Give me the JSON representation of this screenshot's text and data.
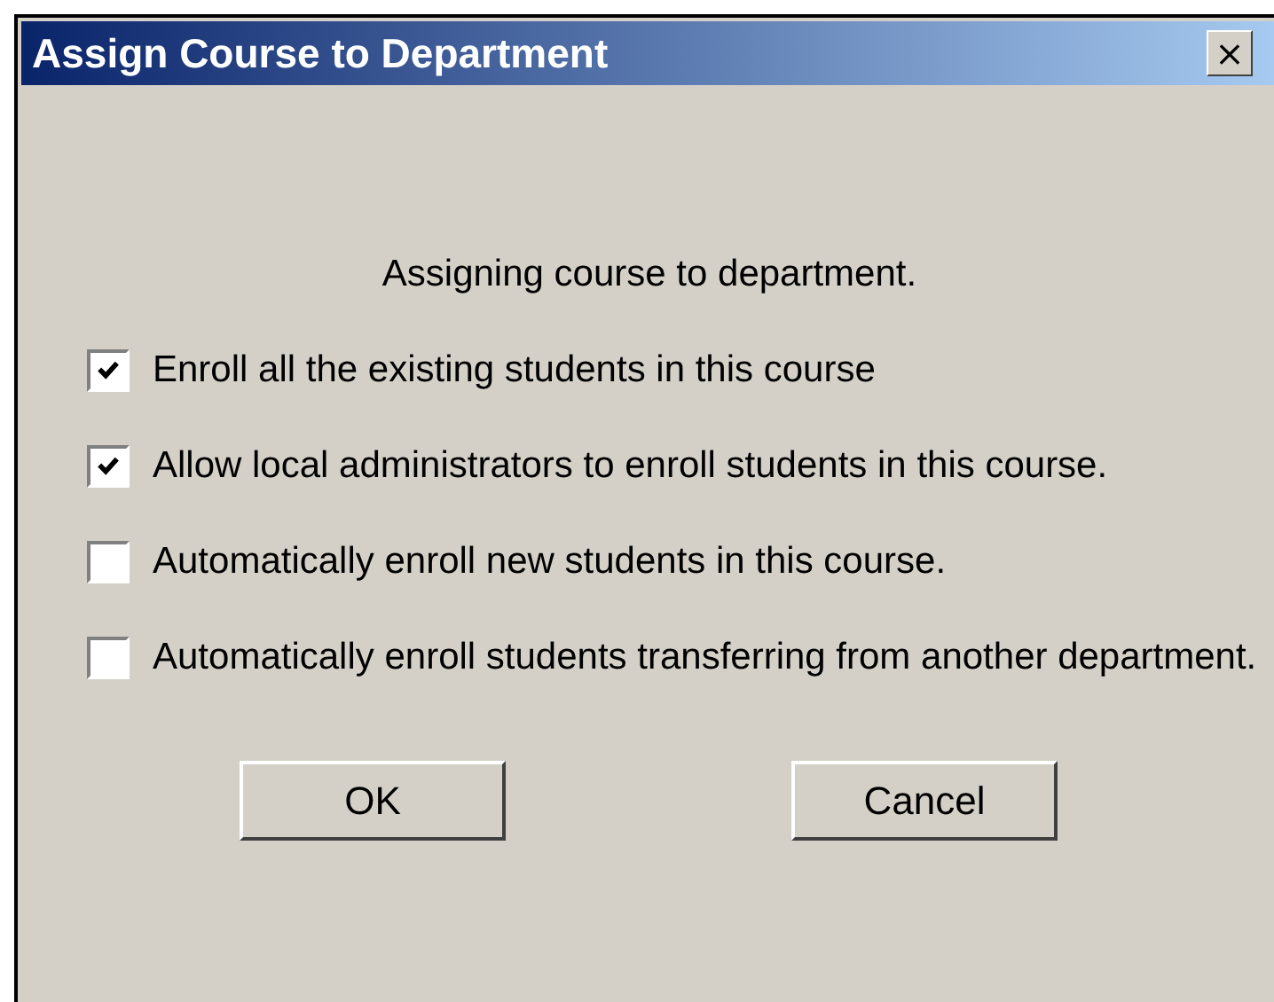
{
  "window": {
    "title": "Assign Course to Department",
    "close": "×"
  },
  "message": "Assigning course to department.",
  "options": [
    {
      "label": "Enroll all the existing students in this course",
      "checked": true
    },
    {
      "label": "Allow local administrators to enroll students in this course.",
      "checked": true
    },
    {
      "label": "Automatically enroll new students in this course.",
      "checked": false
    },
    {
      "label": "Automatically enroll students transferring from another department.",
      "checked": false
    }
  ],
  "buttons": [
    "OK",
    "Cancel"
  ]
}
